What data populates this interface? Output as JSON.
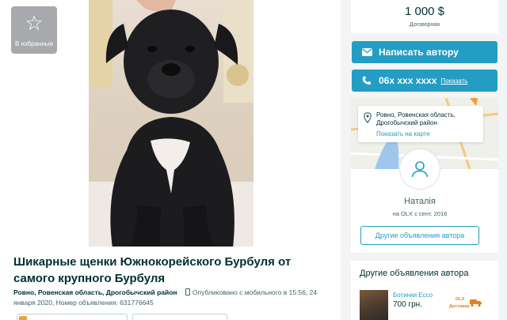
{
  "favorite": {
    "label": "В избранные",
    "icon": "star-icon"
  },
  "ad": {
    "title": "Шикарные щенки Южнокорейского Бурбуля от самого крупного Бурбуля",
    "location": "Ровно, Ровенская область, Дрогобычский район",
    "published_prefix": "Опубликовано с мобильного",
    "published_time": "в 15:56, 24 января 2020, Номер объявления: 631776645"
  },
  "price": {
    "value": "1 000 $",
    "note": "Договорная"
  },
  "buttons": {
    "message": "Написать автору",
    "phone": "06х ххх хххх",
    "phone_show": "Показать"
  },
  "map": {
    "location": "Ровно, Ровенская область, Дрогобычский район",
    "show_on_map": "Показать на карте"
  },
  "seller": {
    "name": "Наталія",
    "since": "на OLX с сент. 2016",
    "other_ads_button": "Другие объявления автора"
  },
  "other_ads": {
    "heading": "Другие объявления автора",
    "item_title": "Ботинки Ессо",
    "item_price": "700 грн.",
    "badge_top": "OLX",
    "badge_bottom": "Доставка"
  },
  "colors": {
    "accent": "#239dc4",
    "text": "#002f34",
    "badge": "#e67e22",
    "fav_bg": "#a7a9ac"
  }
}
